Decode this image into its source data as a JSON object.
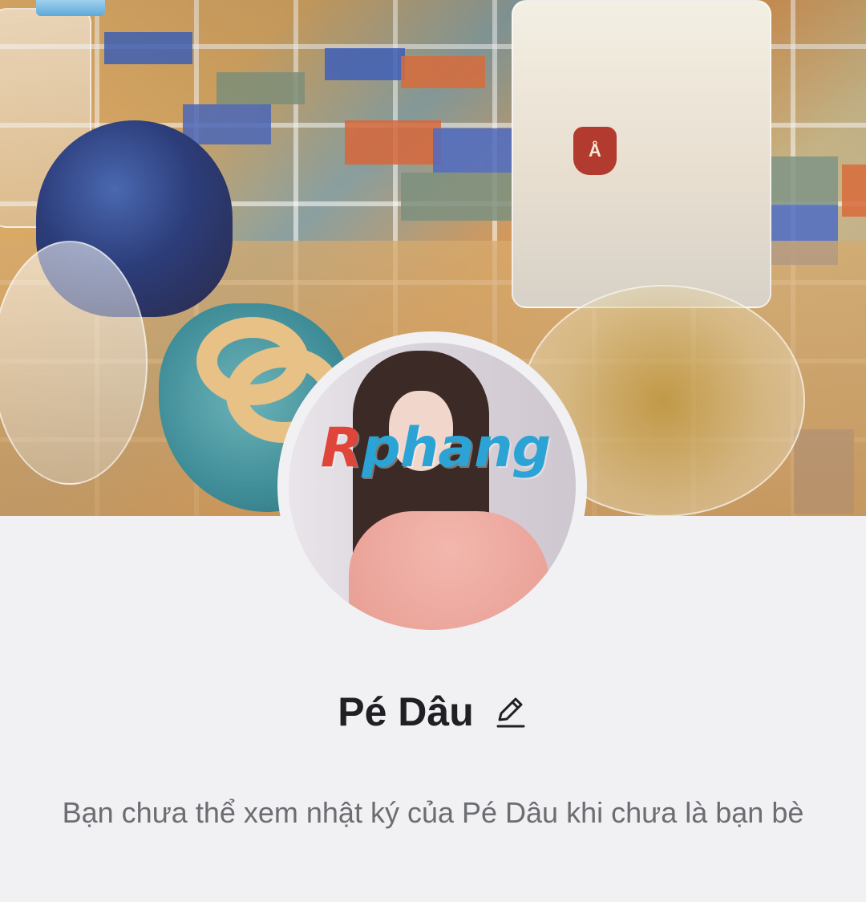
{
  "profile": {
    "name": "Pé Dâu",
    "avatar_watermark": "Rphang",
    "diary_message": "Bạn chưa thể xem nhật ký của Pé Dâu khi chưa là bạn bè"
  },
  "icons": {
    "edit": "pencil-icon"
  },
  "colors": {
    "background": "#f1f1f4",
    "name_text": "#1f1f24",
    "message_text": "#6b6d72"
  }
}
